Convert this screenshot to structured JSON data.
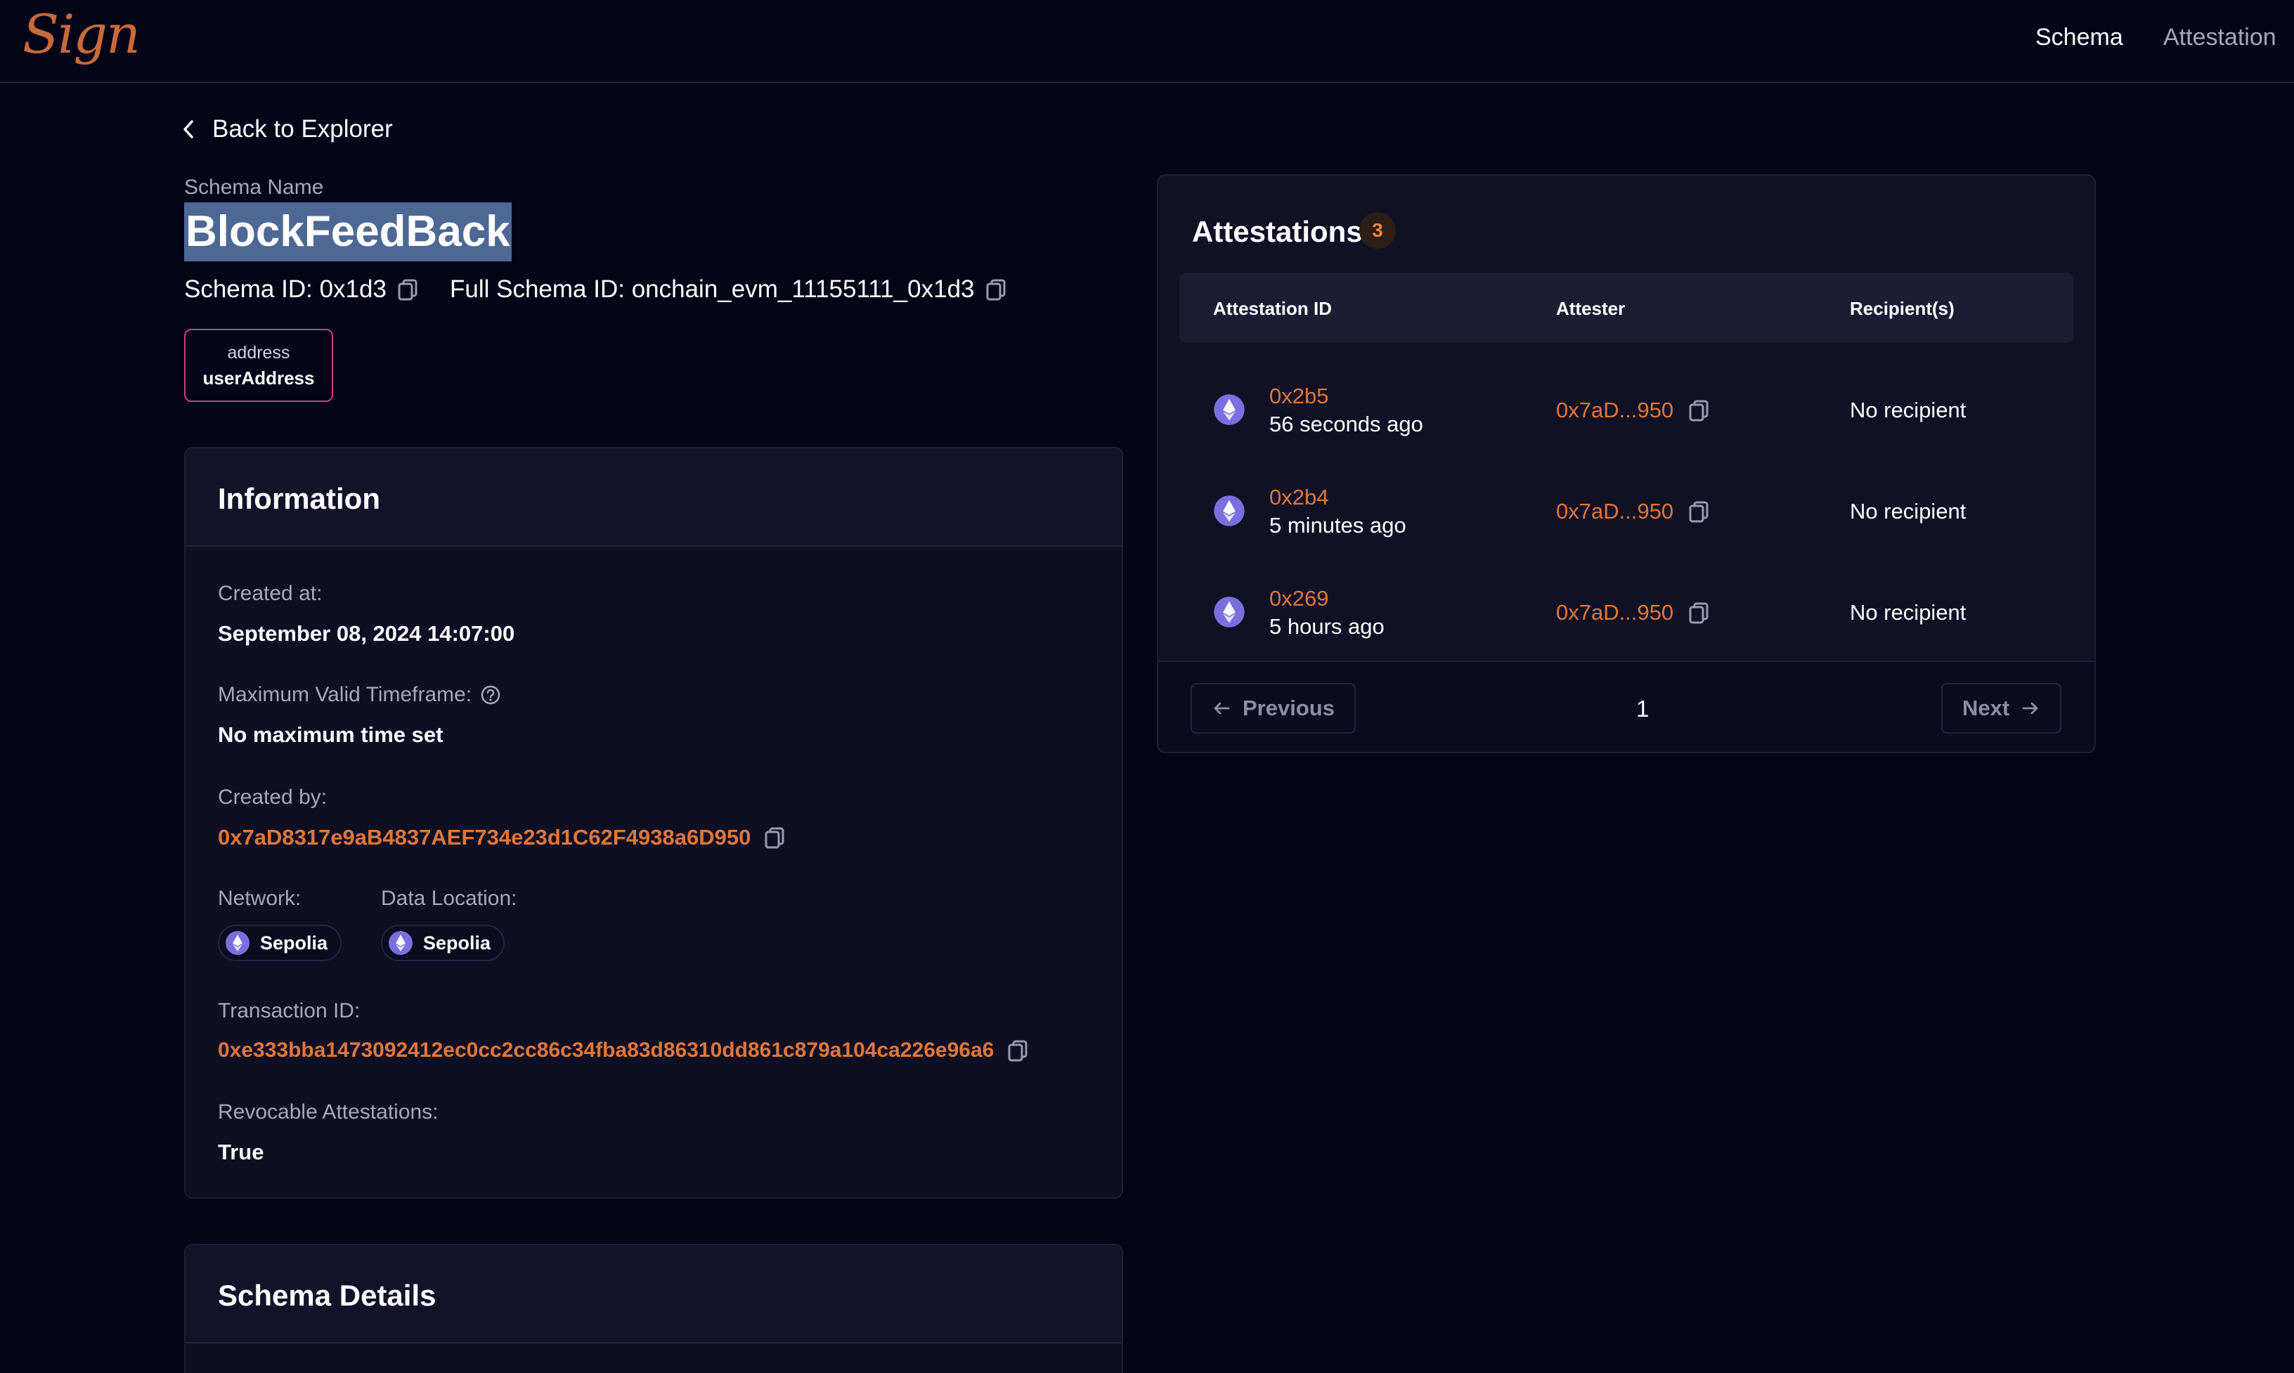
{
  "header": {
    "logo": "Sign",
    "nav": [
      "Schema",
      "Attestation"
    ]
  },
  "back_label": "Back to Explorer",
  "schema": {
    "name_label": "Schema Name",
    "name": "BlockFeedBack",
    "id_text": "Schema ID: 0x1d3",
    "full_id_text": "Full Schema ID: onchain_evm_11155111_0x1d3",
    "field": {
      "type": "address",
      "name": "userAddress"
    }
  },
  "information": {
    "title": "Information",
    "created_at_label": "Created at:",
    "created_at": "September 08, 2024 14:07:00",
    "max_valid_label": "Maximum Valid Timeframe:",
    "max_valid": "No maximum time set",
    "created_by_label": "Created by:",
    "created_by": "0x7aD8317e9aB4837AEF734e23d1C62F4938a6D950",
    "network_label": "Network:",
    "network": "Sepolia",
    "data_location_label": "Data Location:",
    "data_location": "Sepolia",
    "tx_label": "Transaction ID:",
    "tx": "0xe333bba1473092412ec0cc2cc86c34fba83d86310dd861c879a104ca226e96a6",
    "revocable_label": "Revocable Attestations:",
    "revocable": "True"
  },
  "schema_details": {
    "title": "Schema Details"
  },
  "attestations": {
    "title": "Attestations",
    "count": "3",
    "columns": [
      "Attestation ID",
      "Attester",
      "Recipient(s)"
    ],
    "rows": [
      {
        "id": "0x2b5",
        "time": "56 seconds ago",
        "attester": "0x7aD...950",
        "recipient": "No recipient"
      },
      {
        "id": "0x2b4",
        "time": "5 minutes ago",
        "attester": "0x7aD...950",
        "recipient": "No recipient"
      },
      {
        "id": "0x269",
        "time": "5 hours ago",
        "attester": "0x7aD...950",
        "recipient": "No recipient"
      }
    ],
    "pager": {
      "previous": "Previous",
      "page": "1",
      "next": "Next"
    }
  },
  "colors": {
    "accent": "#e0763a",
    "background": "#050518",
    "chip_border": "#c0457d",
    "eth": "#7b6fe0"
  }
}
